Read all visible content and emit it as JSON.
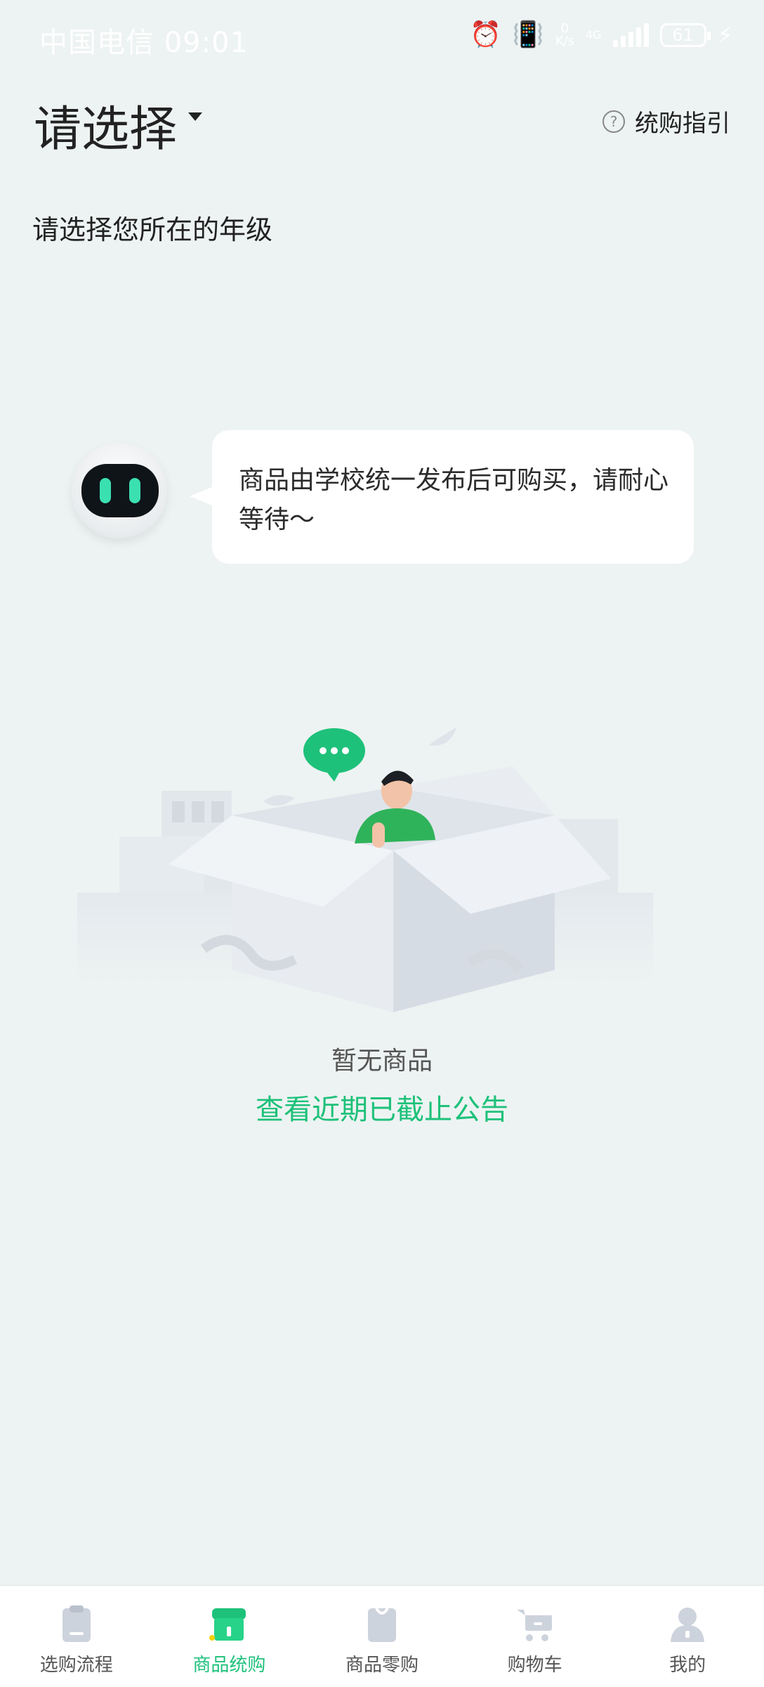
{
  "status_bar": {
    "carrier_time": "中国电信 09:01",
    "speed_value": "0",
    "speed_unit": "K/s",
    "network": "4G",
    "battery": "61"
  },
  "header": {
    "title": "请选择",
    "guide_label": "统购指引"
  },
  "subtitle": "请选择您所在的年级",
  "assistant": {
    "message": "商品由学校统一发布后可购买，请耐心等待～"
  },
  "empty_state": {
    "text": "暂无商品",
    "link": "查看近期已截止公告"
  },
  "bottom_nav": {
    "items": [
      {
        "label": "选购流程",
        "icon": "clipboard-icon"
      },
      {
        "label": "商品统购",
        "icon": "store-icon",
        "active": true
      },
      {
        "label": "商品零购",
        "icon": "bag-icon"
      },
      {
        "label": "购物车",
        "icon": "cart-icon"
      },
      {
        "label": "我的",
        "icon": "user-icon"
      }
    ]
  },
  "colors": {
    "accent": "#1ec17a",
    "background": "#edf3f2",
    "inactive_icon": "#cdd3dc"
  }
}
